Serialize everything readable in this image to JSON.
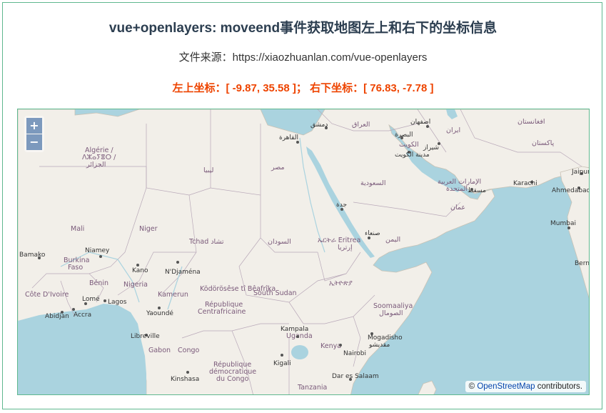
{
  "page": {
    "title": "vue+openlayers: moveend事件获取地图左上和右下的坐标信息",
    "source": "文件来源：https://xiaozhuanlan.com/vue-openlayers",
    "coords_text": "左上坐标：[ -9.87, 35.58 ]； 右下坐标：[ 76.83, -7.78 ]"
  },
  "coordinates": {
    "top_left": [
      -9.87,
      35.58
    ],
    "bottom_right": [
      76.83,
      -7.78
    ]
  },
  "zoom": {
    "in_label": "+",
    "out_label": "−"
  },
  "attribution": {
    "prefix": "©",
    "link": "OpenStreetMap",
    "suffix": " contributors."
  },
  "map_labels": {
    "countries": [
      "Algérie /",
      "ⴷⵣⴰⵢⴻⵔ /",
      "الجزائر",
      "ليبيا",
      "مصر",
      "Mali",
      "Niger",
      "Tchad تشاد",
      "السودان",
      "السعودية",
      "اليمن",
      "ኤርትራ Eritrea",
      "إرتريا",
      "ኢትዮጵያ",
      "South Sudan",
      "Nigeria",
      "Kamerun",
      "Ködörösêse tî Bêafrîka",
      "République",
      "Centrafricaine",
      "Burkina",
      "Faso",
      "Côte D'Ivoire",
      "Bénin",
      "Soomaaliya",
      "الصومال",
      "Uganda",
      "Kenya",
      "Gabon",
      "Congo",
      "République",
      "démocratique",
      "du Congo",
      "Tanzania",
      "العراق",
      "ایران",
      "الإمارات العربية",
      "المتحدة",
      "عمان",
      "پاکستان",
      "افغانستان",
      "الكويت"
    ],
    "cities": [
      "القاهرة",
      "Niamey",
      "Bamako",
      "Kano",
      "N'Djaména",
      "Lomé",
      "Lagos",
      "Abidjan",
      "Accra",
      "Yaoundé",
      "Libreville",
      "Kigali",
      "Kinshasa",
      "Mogadisho",
      "مقديشو",
      "Dar es Salaam",
      "جدة",
      "صنعاء",
      "مسقط",
      "Karachi",
      "Mumbai",
      "Ahmedabad",
      "Jaipur",
      "اصفهان",
      "شیراز",
      "البصرة",
      "مدينة الكويت",
      "دمشق",
      "Bern",
      "Nairobi",
      "Kampala"
    ]
  }
}
